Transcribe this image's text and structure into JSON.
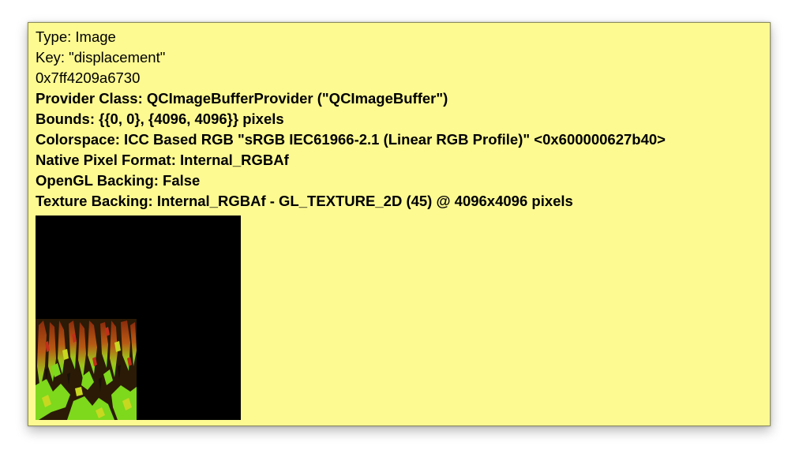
{
  "tooltip": {
    "type_line": "Type: Image",
    "key_line": "Key: \"displacement\"",
    "address_line": "0x7ff4209a6730",
    "provider_line": "Provider Class: QCImageBufferProvider (\"QCImageBuffer\")",
    "bounds_line": "Bounds: {{0, 0}, {4096, 4096}} pixels",
    "colorspace_line": "Colorspace: ICC Based RGB \"sRGB IEC61966-2.1 (Linear RGB Profile)\" <0x600000627b40>",
    "pixel_format_line": "Native Pixel Format: Internal_RGBAf",
    "opengl_line": "OpenGL Backing: False",
    "texture_line": "Texture Backing: Internal_RGBAf - GL_TEXTURE_2D (45) @ 4096x4096 pixels"
  },
  "colors": {
    "tooltip_background": "#fdfa92",
    "preview_background": "#000000"
  }
}
